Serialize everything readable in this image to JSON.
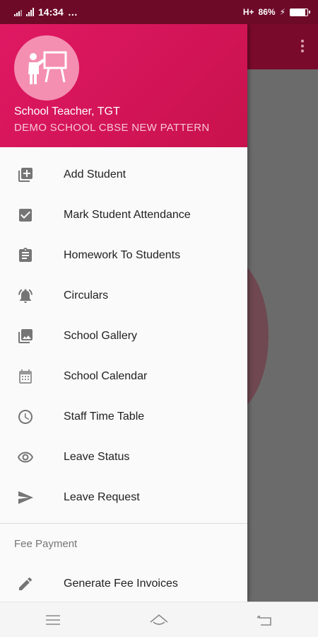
{
  "status_bar": {
    "time": "14:34",
    "dots": "…",
    "network": "H+",
    "battery": "86%",
    "battery_level": 0.86
  },
  "drawer": {
    "profile": {
      "avatar_icon": "teacher-board-icon",
      "name": "School Teacher, TGT",
      "school": "DEMO SCHOOL CBSE NEW PATTERN"
    },
    "menu_items": [
      {
        "label": "Add Student",
        "icon": "add-box-icon"
      },
      {
        "label": "Mark Student Attendance",
        "icon": "check-box-icon"
      },
      {
        "label": "Homework To Students",
        "icon": "clipboard-icon"
      },
      {
        "label": "Circulars",
        "icon": "bell-icon"
      },
      {
        "label": "School Gallery",
        "icon": "gallery-icon"
      },
      {
        "label": "School Calendar",
        "icon": "calendar-icon"
      },
      {
        "label": "Staff Time Table",
        "icon": "clock-icon"
      },
      {
        "label": "Leave Status",
        "icon": "eye-icon"
      },
      {
        "label": "Leave Request",
        "icon": "send-icon"
      }
    ],
    "section_fee": {
      "title": "Fee Payment",
      "items": [
        {
          "label": "Generate Fee Invoices",
          "icon": "pencil-icon"
        }
      ]
    }
  },
  "nav_bar": {
    "buttons": [
      "menu-icon",
      "home-icon",
      "back-icon"
    ]
  },
  "colors": {
    "header": "#e01863",
    "status_bar": "#6d0a28",
    "toolbar": "#7a0a2c",
    "avatar": "#f48fb1"
  }
}
